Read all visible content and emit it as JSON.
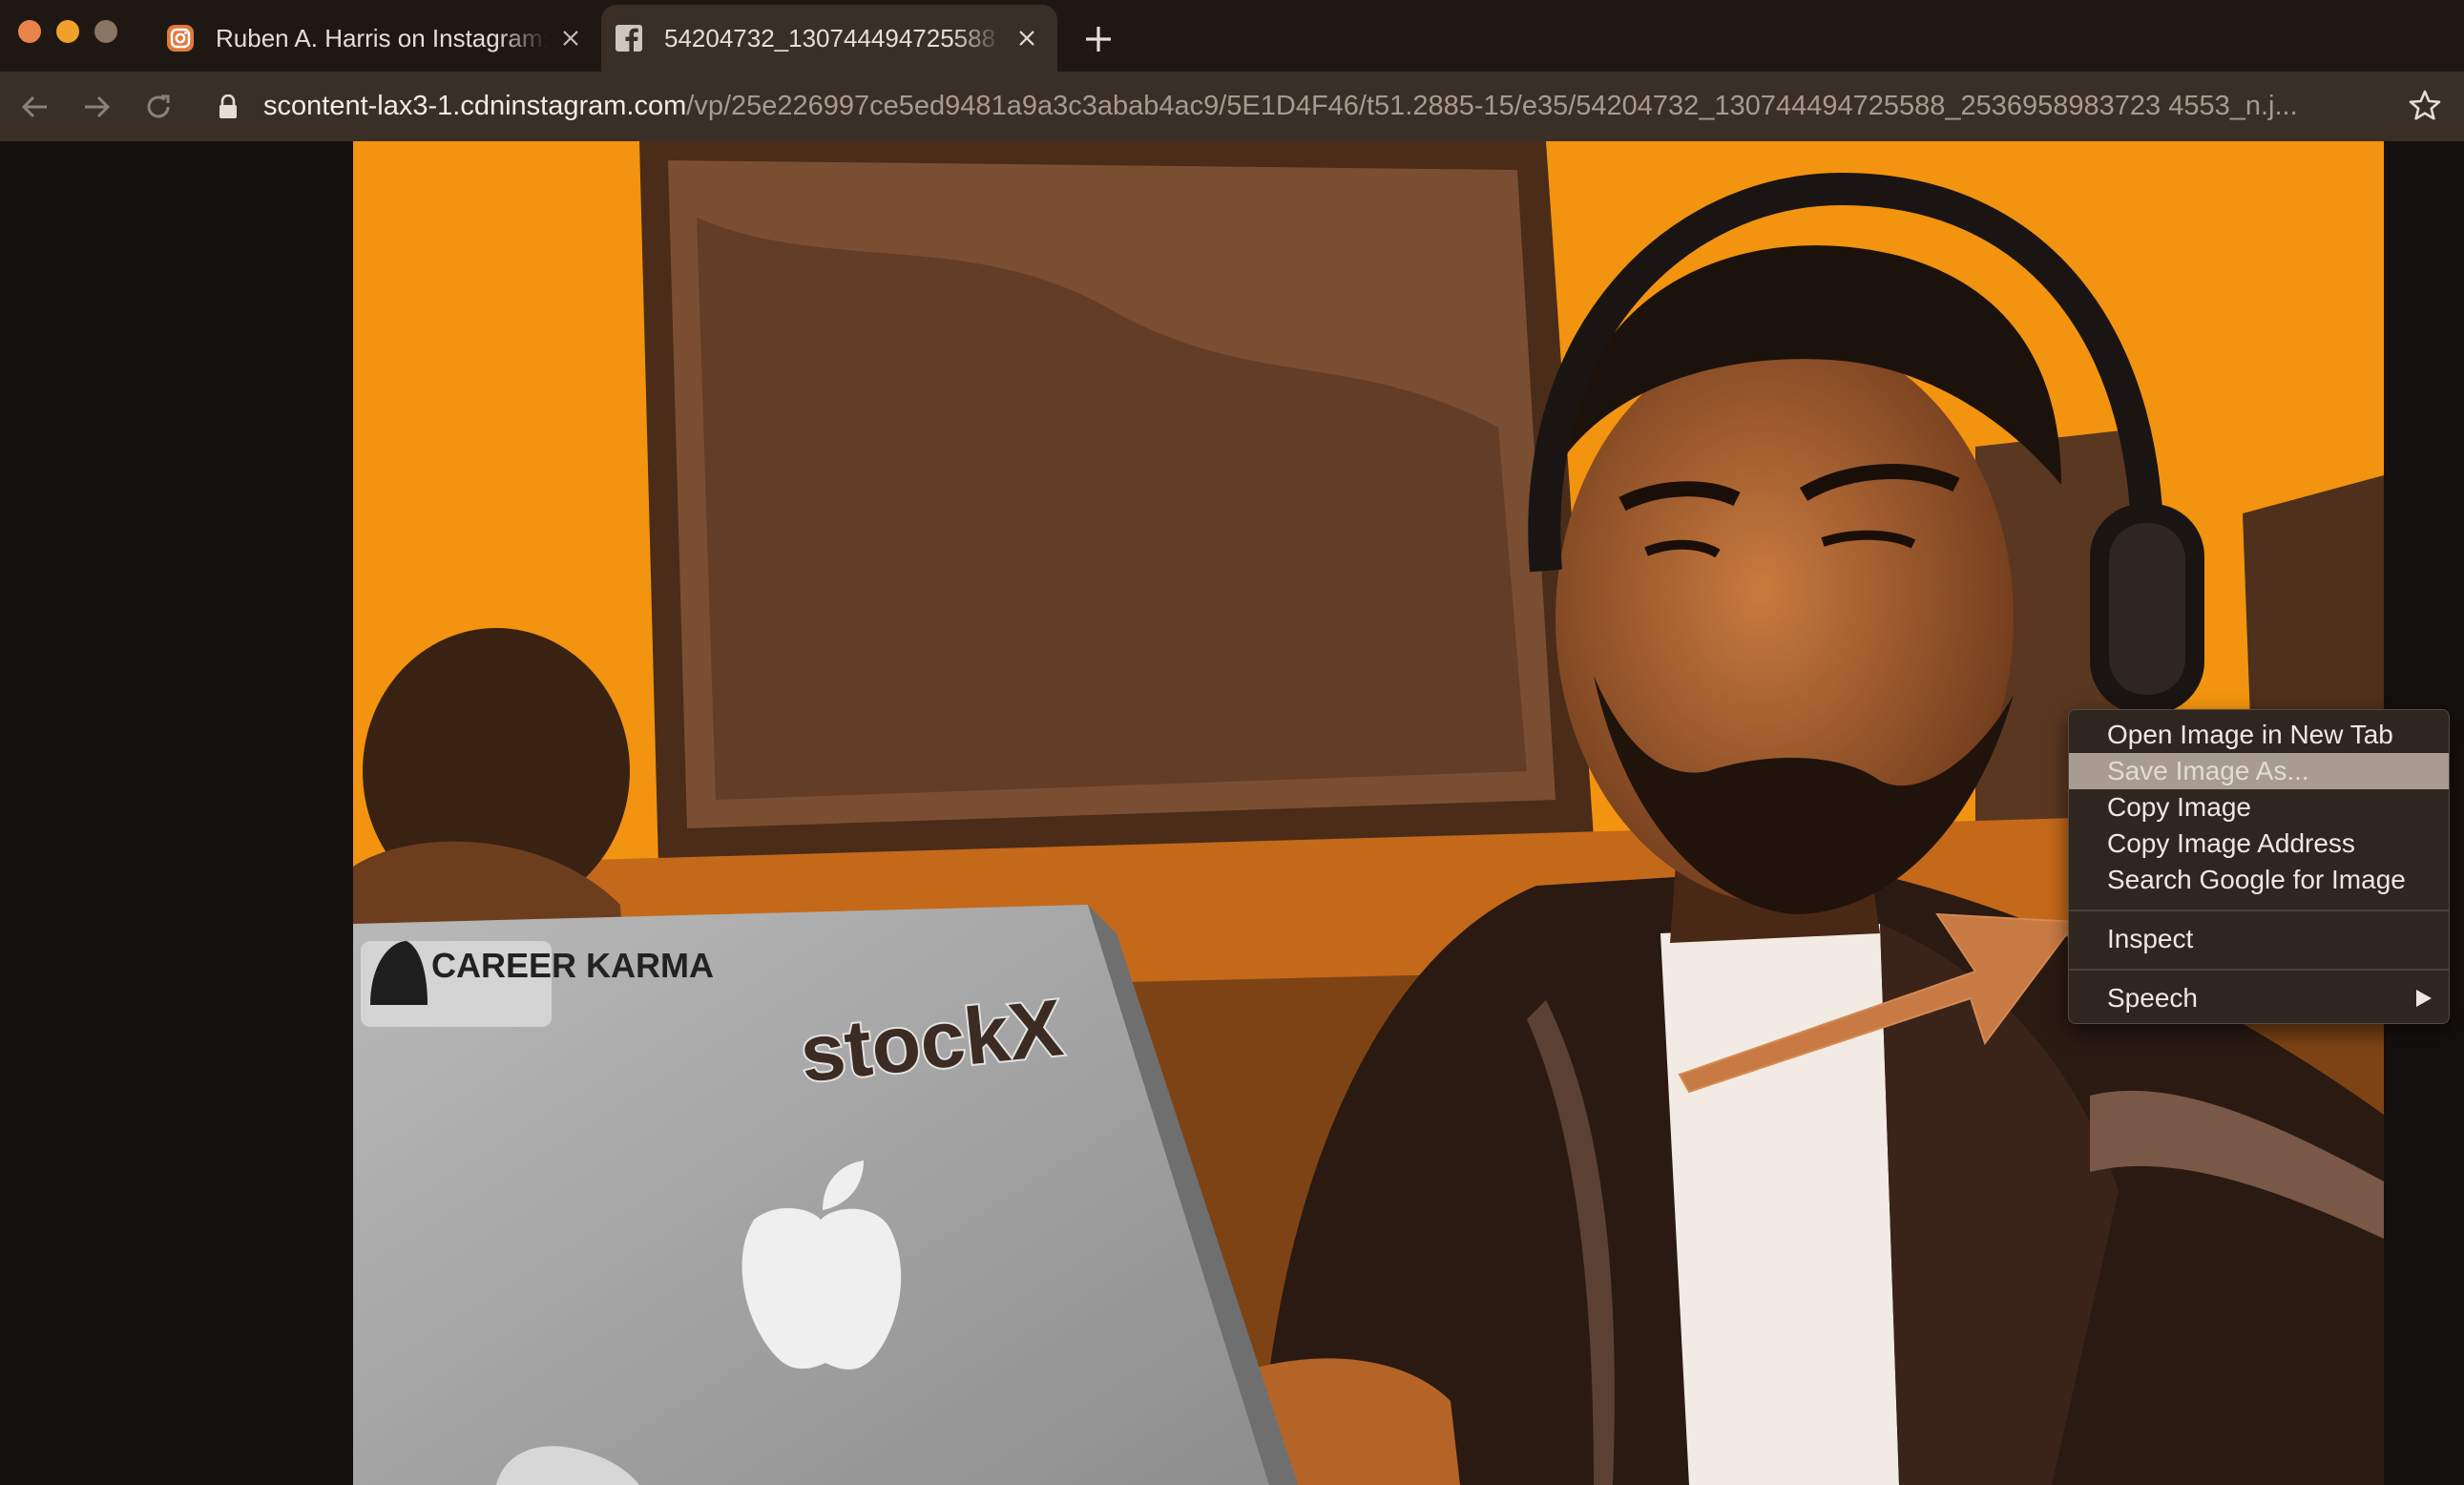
{
  "browser": {
    "tabs": [
      {
        "title": "Ruben A. Harris on Instagram:",
        "favicon": "instagram-icon",
        "active": false
      },
      {
        "title": "54204732_130744494725588",
        "favicon": "facebook-icon",
        "active": true
      }
    ],
    "url": {
      "host": "scontent-lax3-1.cdninstagram.com",
      "path": "/vp/25e226997ce5ed9481a9a3c3abab4ac9/5E1D4F46/t51.2885-15/e35/54204732_130744494725588_2536958983723 4553_n.j..."
    }
  },
  "photo": {
    "sticker_1": "CAREER KARMA",
    "sticker_2": "stockX"
  },
  "context_menu": {
    "items": [
      {
        "label": "Open Image in New Tab"
      },
      {
        "label": "Save Image As...",
        "highlighted": true
      },
      {
        "label": "Copy Image"
      },
      {
        "label": "Copy Image Address"
      },
      {
        "label": "Search Google for Image"
      },
      {
        "label": "Inspect"
      },
      {
        "label": "Speech",
        "submenu": true
      }
    ]
  },
  "colors": {
    "accent_orange": "#f2940f",
    "arrow": "#c87a44",
    "tab_active": "#3a2f27",
    "tabstrip": "#1f1812"
  }
}
